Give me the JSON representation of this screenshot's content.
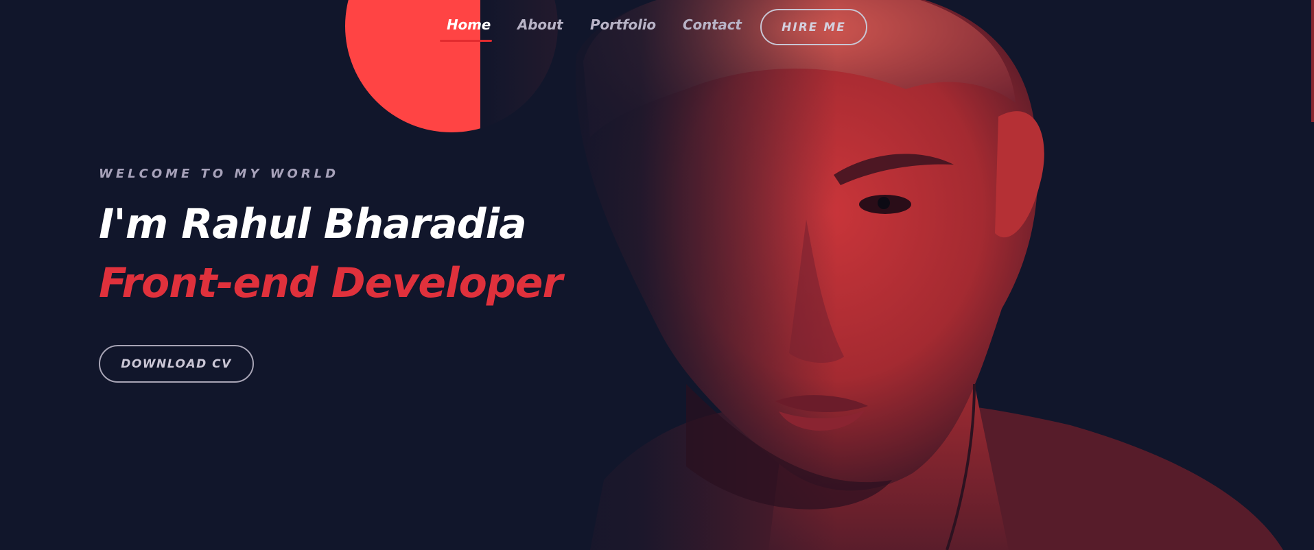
{
  "nav": {
    "items": [
      {
        "label": "Home",
        "active": true
      },
      {
        "label": "About",
        "active": false
      },
      {
        "label": "Portfolio",
        "active": false
      },
      {
        "label": "Contact",
        "active": false
      }
    ],
    "hire_label": "HIRE ME"
  },
  "hero": {
    "welcome": "WELCOME TO MY WORLD",
    "name": "I'm Rahul Bharadia",
    "role": "Front-end Developer",
    "cv_label": "DOWNLOAD CV"
  },
  "colors": {
    "background": "#11162b",
    "accent": "#e0313c",
    "circle": "#ff4444"
  }
}
